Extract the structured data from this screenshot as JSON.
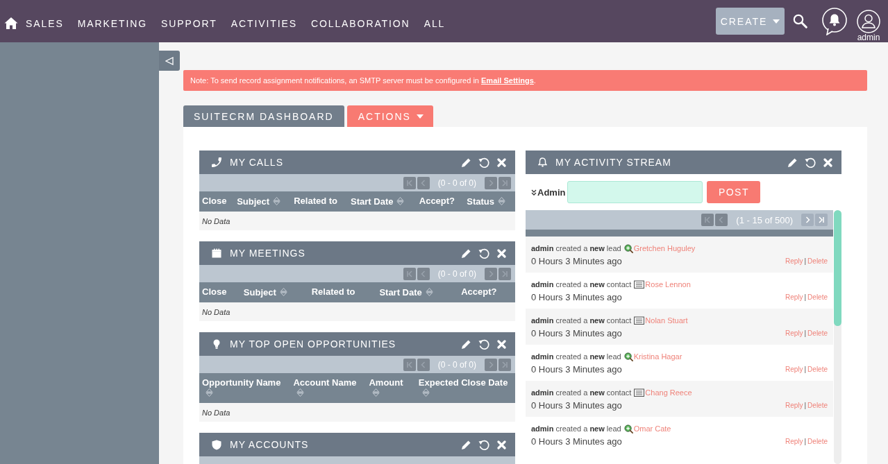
{
  "topbar": {
    "nav": [
      "SALES",
      "MARKETING",
      "SUPPORT",
      "ACTIVITIES",
      "COLLABORATION",
      "ALL"
    ],
    "create": "CREATE",
    "user": "admin"
  },
  "notice": {
    "text": "Note: To send record assignment notifications, an SMTP server must be configured in",
    "link": "Email Settings",
    "end": "."
  },
  "tabs": [
    {
      "label": "SUITECRM DASHBOARD",
      "selected": true
    }
  ],
  "actions_menu": "ACTIONS",
  "dashlets": [
    {
      "title": "MY CALLS",
      "kind": "calls",
      "pagination": {
        "back": [
          {
            "kind": "first",
            "disabled": true
          },
          {
            "kind": "prev",
            "disabled": true
          }
        ],
        "text": "(0 - 0 of 0)",
        "forward": [
          {
            "kind": "next",
            "disabled": true
          },
          {
            "kind": "last",
            "disabled": true
          }
        ]
      },
      "columns": [
        {
          "label": "Close",
          "sortable": false
        },
        {
          "label": "Subject",
          "sortable": true
        },
        {
          "label": "Related to",
          "sortable": false
        },
        {
          "label": "Start Date",
          "sortable": true
        },
        {
          "label": "Accept?",
          "sortable": false
        },
        {
          "label": "Status",
          "sortable": true
        }
      ],
      "empty": "No Data"
    },
    {
      "title": "MY MEETINGS",
      "kind": "meetings",
      "pagination": {
        "back": [
          {
            "kind": "first",
            "disabled": true
          },
          {
            "kind": "prev",
            "disabled": true
          }
        ],
        "text": "(0 - 0 of 0)",
        "forward": [
          {
            "kind": "next",
            "disabled": true
          },
          {
            "kind": "last",
            "disabled": true
          }
        ]
      },
      "columns": [
        {
          "label": "Close",
          "sortable": false
        },
        {
          "label": "Subject",
          "sortable": true
        },
        {
          "label": "Related to",
          "sortable": false
        },
        {
          "label": "Start Date",
          "sortable": true
        },
        {
          "label": "Accept?",
          "sortable": false
        }
      ],
      "empty": "No Data"
    },
    {
      "title": "MY TOP OPEN OPPORTUNITIES",
      "kind": "opportunities",
      "pagination": {
        "back": [
          {
            "kind": "first",
            "disabled": true
          },
          {
            "kind": "prev",
            "disabled": true
          }
        ],
        "text": "(0 - 0 of 0)",
        "forward": [
          {
            "kind": "next",
            "disabled": true
          },
          {
            "kind": "last",
            "disabled": true
          }
        ]
      },
      "columns": [
        {
          "label": "Opportunity Name",
          "sortable": true
        },
        {
          "label": "Account Name",
          "sortable": true
        },
        {
          "label": "Amount",
          "sortable": true
        },
        {
          "label": "Expected Close Date",
          "sortable": true
        }
      ],
      "empty": "No Data"
    },
    {
      "title": "MY ACCOUNTS",
      "kind": "accounts"
    }
  ],
  "activity_stream": {
    "title": "MY ACTIVITY STREAM",
    "kind": "activity",
    "user": "Admin",
    "post": "POST",
    "pagination": {
      "back": [
        {
          "kind": "first",
          "disabled": true
        },
        {
          "kind": "prev",
          "disabled": true
        }
      ],
      "text": "(1 - 15 of 500)",
      "forward": [
        {
          "kind": "next",
          "disabled": false
        },
        {
          "kind": "last",
          "disabled": false
        }
      ]
    },
    "entries": [
      {
        "text": "**admin** created a **new** lead",
        "kind": "lead",
        "name": "Gretchen Huguley",
        "time": "0 Hours 3 Minutes ago",
        "reply": "Reply",
        "sep": "|",
        "delete": "Delete"
      },
      {
        "text": "**admin** created a **new** contact",
        "kind": "contact",
        "name": "Rose Lennon",
        "time": "0 Hours 3 Minutes ago",
        "reply": "Reply",
        "sep": "|",
        "delete": "Delete"
      },
      {
        "text": "**admin** created a **new** contact",
        "kind": "contact",
        "name": "Nolan Stuart",
        "time": "0 Hours 3 Minutes ago",
        "reply": "Reply",
        "sep": "|",
        "delete": "Delete"
      },
      {
        "text": "**admin** created a **new** lead",
        "kind": "lead",
        "name": "Kristina Hagar",
        "time": "0 Hours 3 Minutes ago",
        "reply": "Reply",
        "sep": "|",
        "delete": "Delete"
      },
      {
        "text": "**admin** created a **new** contact",
        "kind": "contact",
        "name": "Chang Reece",
        "time": "0 Hours 3 Minutes ago",
        "reply": "Reply",
        "sep": "|",
        "delete": "Delete"
      },
      {
        "text": "**admin** created a **new** lead",
        "kind": "lead",
        "name": "Omar Cate",
        "time": "0 Hours 3 Minutes ago",
        "reply": "Reply",
        "sep": "|",
        "delete": "Delete"
      }
    ]
  }
}
